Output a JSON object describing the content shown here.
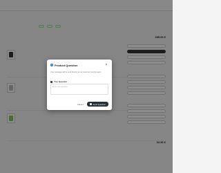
{
  "header": {
    "links": [
      "",
      "",
      ""
    ],
    "title": "",
    "total": "285.00 €"
  },
  "rows": [
    {
      "name": "",
      "meta": ""
    },
    {
      "name": "",
      "meta": ""
    },
    {
      "name": "",
      "meta": ""
    }
  ],
  "footer": {
    "total": "32.90 €"
  },
  "modal": {
    "title": "Product Question",
    "description": "Your message will be sent directly to our customer service team.",
    "label": "Your Question",
    "placeholder": "Enter your question...",
    "cancel_label": "Cancel",
    "send_label": "Send Question",
    "close_glyph": "×",
    "help_glyph": "?"
  },
  "colors": {
    "accent": "#1976d2",
    "send_button": "#263238",
    "overlay": "rgba(0,0,0,0.45)"
  }
}
